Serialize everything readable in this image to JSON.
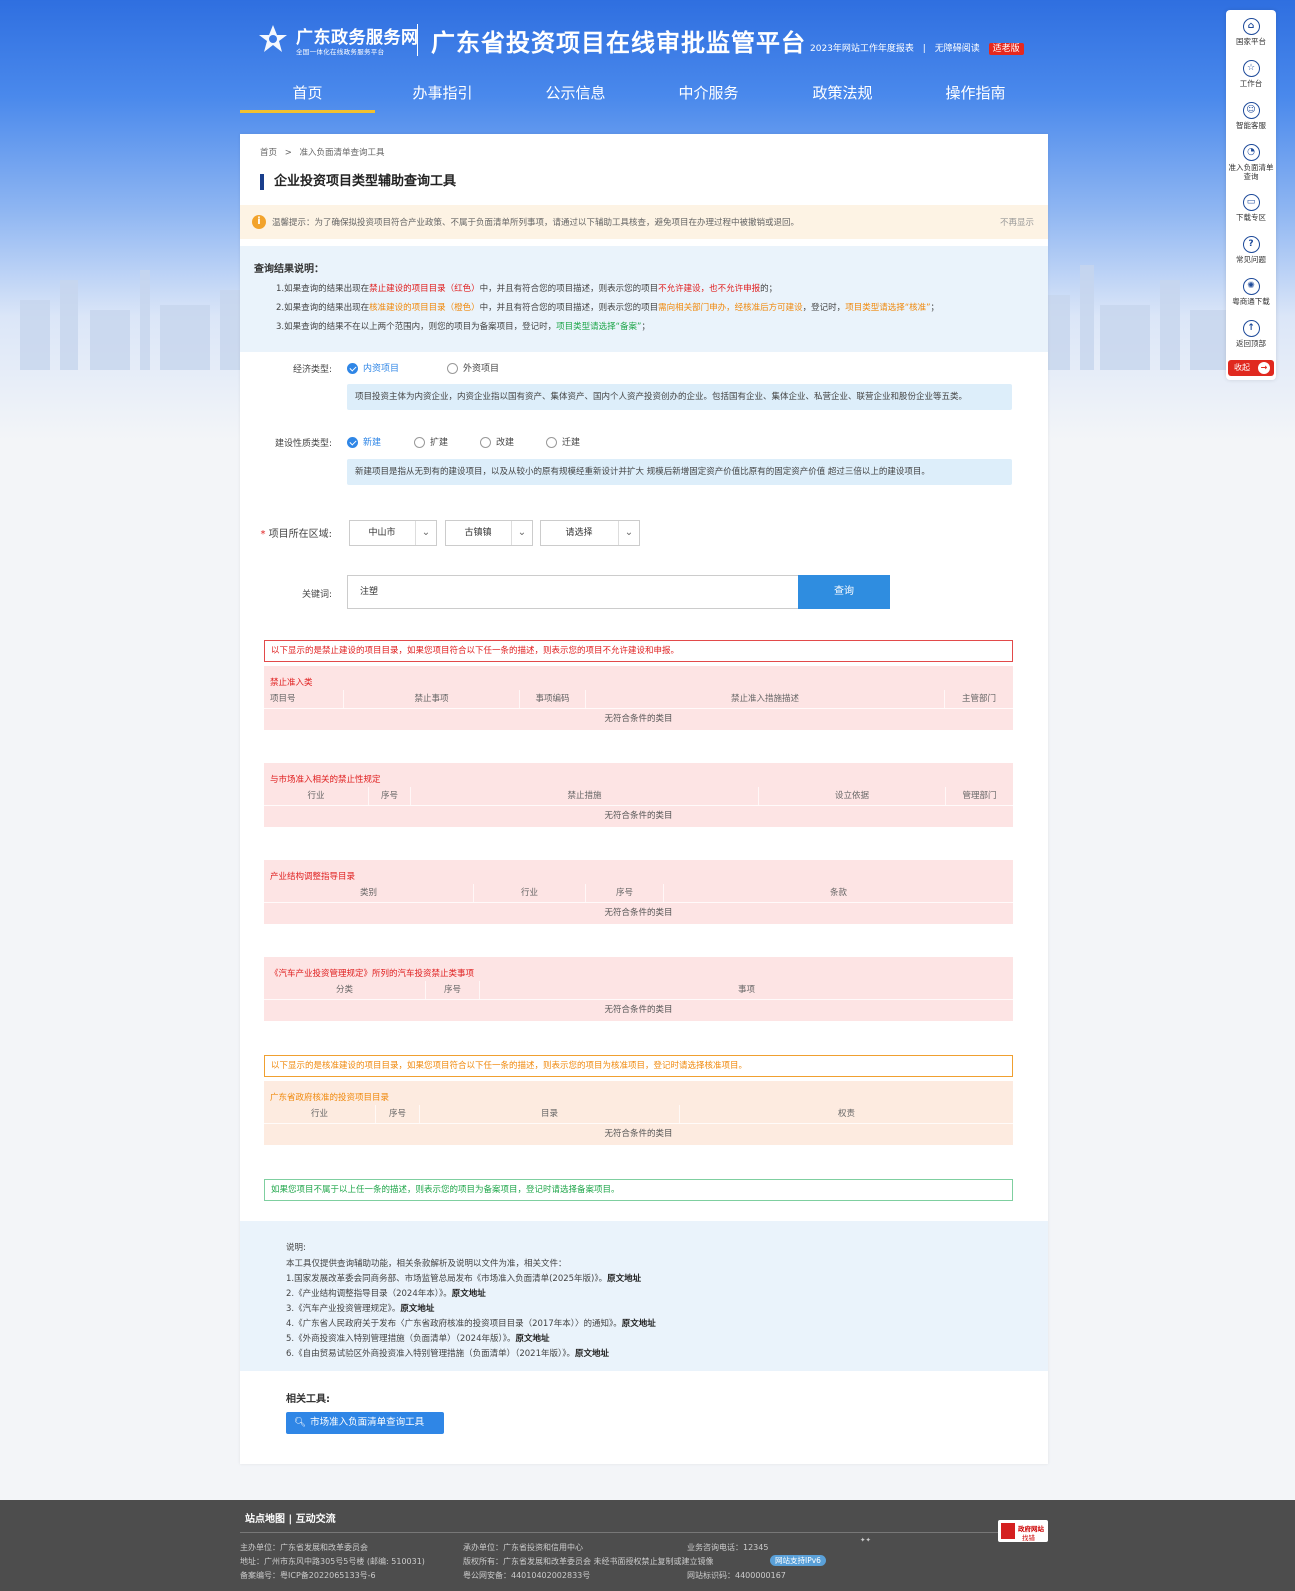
{
  "header": {
    "brand_name": "广东政务服务网",
    "brand_sub": "全国一体化在线政务服务平台",
    "platform_title": "广东省投资项目在线审批监管平台",
    "report_link": "2023年网站工作年度报表",
    "separator": "|",
    "accessibility_link": "无障碍阅读",
    "elder_mode": "适老版"
  },
  "nav": {
    "items": [
      "首页",
      "办事指引",
      "公示信息",
      "中介服务",
      "政策法规",
      "操作指南"
    ],
    "active_index": 0
  },
  "breadcrumb": {
    "home": "首页",
    "sep": ">",
    "current": "准入负面清单查询工具"
  },
  "page_title": "企业投资项目类型辅助查询工具",
  "warning": {
    "text": "温馨提示：为了确保拟投资项目符合产业政策、不属于负面清单所列事项，请通过以下辅助工具核查，避免项目在办理过程中被撤销或退回。",
    "close": "不再显示"
  },
  "explain": {
    "title": "查询结果说明：",
    "line1": {
      "a": "1.如果查询的结果出现在",
      "b": "禁止建设的项目目录（红色）",
      "c": "中，并且有符合您的项目描述，则表示您的项目",
      "d": "不允许建设，也不允许申报",
      "e": "的；"
    },
    "line2": {
      "a": "2.如果查询的结果出现在",
      "b": "核准建设的项目目录（橙色）",
      "c": "中，并且有符合您的项目描述，则表示您的项目",
      "d": "需向相关部门申办，经核准后方可建设",
      "e": "，登记时，",
      "f": "项目类型请选择“核准”",
      "g": "；"
    },
    "line3": {
      "a": "3.如果查询的结果不在以上两个范围内，则您的项目为备案项目，登记时，",
      "b": "项目类型请选择“备案”",
      "c": "；"
    }
  },
  "form": {
    "economy_label": "经济类型:",
    "economy_options": [
      "内资项目",
      "外资项目"
    ],
    "economy_selected": 0,
    "economy_hint": "项目投资主体为内资企业，内资企业指以国有资产、集体资产、国内个人资产投资创办的企业。包括国有企业、集体企业、私营企业、联营企业和股份企业等五类。",
    "nature_label": "建设性质类型:",
    "nature_options": [
      "新建",
      "扩建",
      "改建",
      "迁建"
    ],
    "nature_selected": 0,
    "nature_hint": "新建项目是指从无到有的建设项目，以及从较小的原有规模经重新设计并扩大 规模后新增固定资产价值比原有的固定资产价值 超过三倍以上的建设项目。",
    "region_label": "项目所在区域:",
    "required_mark": "*",
    "region_city": "中山市",
    "region_town": "古镇镇",
    "region_village": "请选择",
    "keyword_label": "关键词:",
    "keyword_value": "注塑",
    "query_button": "查询"
  },
  "forbidden_notice": "以下显示的是禁止建设的项目目录，如果您项目符合以下任一条的描述，则表示您的项目不允许建设和申报。",
  "tables": [
    {
      "title": "禁止准入类",
      "headers": [
        "项目号",
        "禁止事项",
        "事项编码",
        "禁止准入措施描述",
        "主管部门"
      ],
      "empty": "无符合条件的类目"
    },
    {
      "title": "与市场准入相关的禁止性规定",
      "headers": [
        "行业",
        "序号",
        "禁止措施",
        "设立依据",
        "管理部门"
      ],
      "empty": "无符合条件的类目"
    },
    {
      "title": "产业结构调整指导目录",
      "headers": [
        "类别",
        "行业",
        "序号",
        "条款"
      ],
      "empty": "无符合条件的类目"
    },
    {
      "title": "《汽车产业投资管理规定》所列的汽车投资禁止类事项",
      "headers": [
        "分类",
        "序号",
        "事项"
      ],
      "empty": "无符合条件的类目"
    }
  ],
  "approval_notice": "以下显示的是核准建设的项目目录，如果您项目符合以下任一条的描述，则表示您的项目为核准项目，登记时请选择核准项目。",
  "approval_table": {
    "title": "广东省政府核准的投资项目目录",
    "headers": [
      "行业",
      "序号",
      "目录",
      "权责"
    ],
    "empty": "无符合条件的类目"
  },
  "filing_notice": "如果您项目不属于以上任一条的描述，则表示您的项目为备案项目，登记时请选择备案项目。",
  "notes": {
    "title": "说明:",
    "intro": "本工具仅提供查询辅助功能，相关条款解析及说明以文件为准，相关文件：",
    "link_label": "原文地址",
    "items": [
      "1.国家发展改革委会同商务部、市场监管总局发布《市场准入负面清单(2025年版)》。",
      "2.《产业结构调整指导目录（2024年本）》。",
      "3.《汽车产业投资管理规定》。",
      "4.《广东省人民政府关于发布〈广东省政府核准的投资项目目录（2017年本）〉的通知》。",
      "5.《外商投资准入特别管理措施（负面清单）（2024年版）》。",
      "6.《自由贸易试验区外商投资准入特别管理措施（负面清单）（2021年版）》。"
    ]
  },
  "tools": {
    "title": "相关工具:",
    "button": "市场准入负面清单查询工具"
  },
  "sidebar": {
    "items": [
      "国家平台",
      "工作台",
      "智能客服",
      "准入负面清单查询",
      "下载专区",
      "常见问题",
      "粤商通下载",
      "返回顶部"
    ],
    "collapse": "收起"
  },
  "footer": {
    "links": "站点地图 | 互动交流",
    "sponsor": "主办单位：广东省发展和改革委员会",
    "address": "地址：广州市东风中路305号5号楼 (邮编: 510031)",
    "icp": "备案编号：粤ICP备2022065133号-6",
    "organizer": "承办单位：广东省投资和信用中心",
    "copyright": "版权所有：广东省发展和改革委员会 未经书面授权禁止复制或建立镜像",
    "police": "粤公网安备：44010402002833号",
    "hotline": "业务咨询电话：12345",
    "ipv6": "网站支持IPv6",
    "site_code": "网站标识码：4400000167",
    "gov_badge_1": "政府网站",
    "gov_badge_2": "找错"
  },
  "colors": {
    "primary": "#2f86e6",
    "forbid": "#e02020",
    "approve": "#f08a0e",
    "filing": "#1fa64a",
    "nav_active": "#f2c02e"
  }
}
